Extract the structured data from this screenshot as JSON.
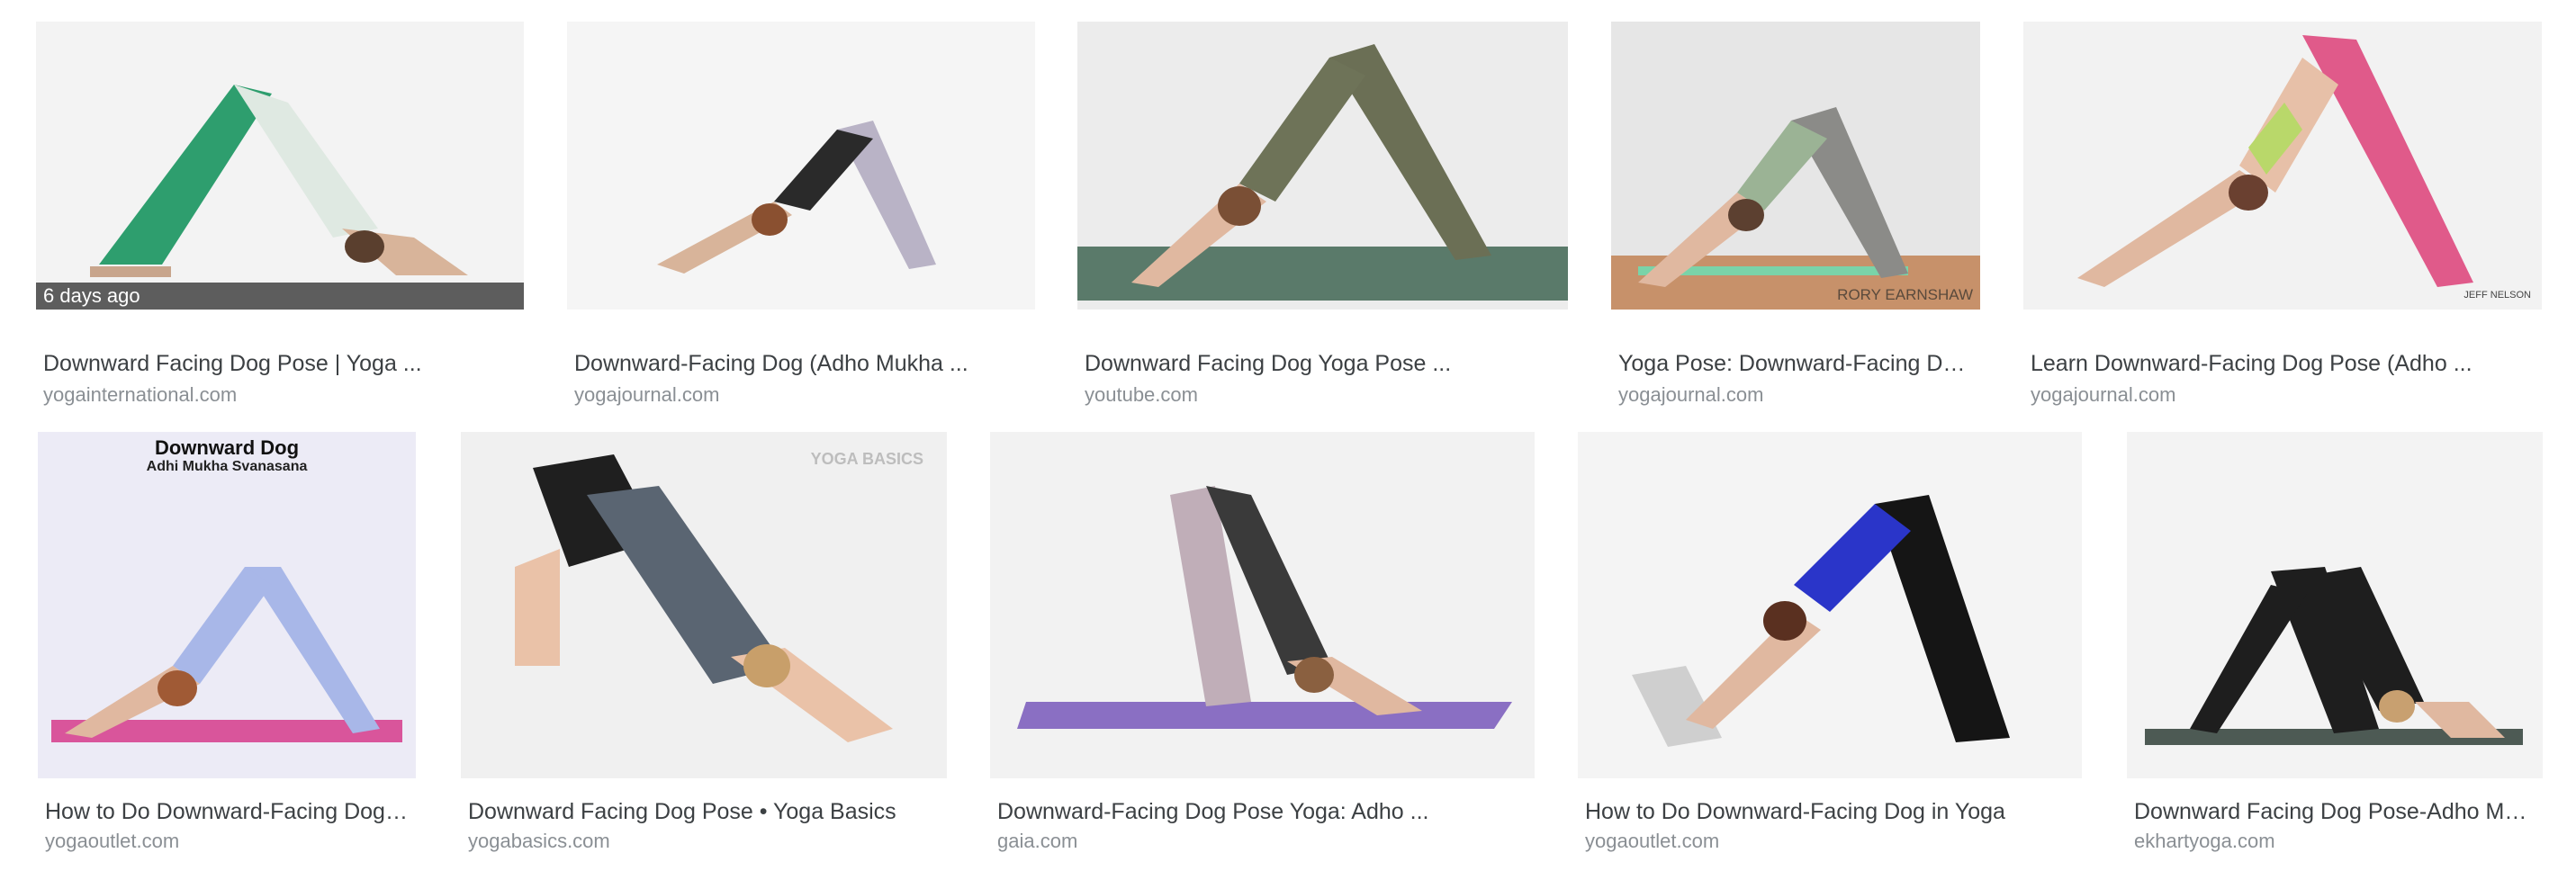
{
  "results": [
    {
      "title": "Downward Facing Dog Pose | Yoga ...",
      "source": "yogainternational.com",
      "badge": "6 days ago"
    },
    {
      "title": "Downward-Facing Dog (Adho Mukha ...",
      "source": "yogajournal.com"
    },
    {
      "title": "Downward Facing Dog Yoga Pose ...",
      "source": "youtube.com"
    },
    {
      "title": "Yoga Pose: Downward-Facing Dog...",
      "source": "yogajournal.com",
      "watermark": "RORY EARNSHAW"
    },
    {
      "title": "Learn Downward-Facing Dog Pose (Adho ...",
      "source": "yogajournal.com",
      "watermark": "JEFF NELSON"
    },
    {
      "title": "How to Do Downward-Facing Dog i...",
      "source": "yogaoutlet.com",
      "image_heading": "Downward Dog",
      "image_subheading": "Adhi Mukha Svanasana"
    },
    {
      "title": "Downward Facing Dog Pose • Yoga Basics",
      "source": "yogabasics.com",
      "watermark": "YOGA BASICS"
    },
    {
      "title": "Downward-Facing Dog Pose Yoga: Adho ...",
      "source": "gaia.com"
    },
    {
      "title": "How to Do Downward-Facing Dog in Yoga",
      "source": "yogaoutlet.com"
    },
    {
      "title": "Downward Facing Dog Pose-Adho Muk...",
      "source": "ekhartyoga.com"
    }
  ],
  "colors": {
    "thumb_bg": "#f4f4f4",
    "title": "#3c4043",
    "source": "#8a8f94",
    "badge_bg": "#505050"
  }
}
